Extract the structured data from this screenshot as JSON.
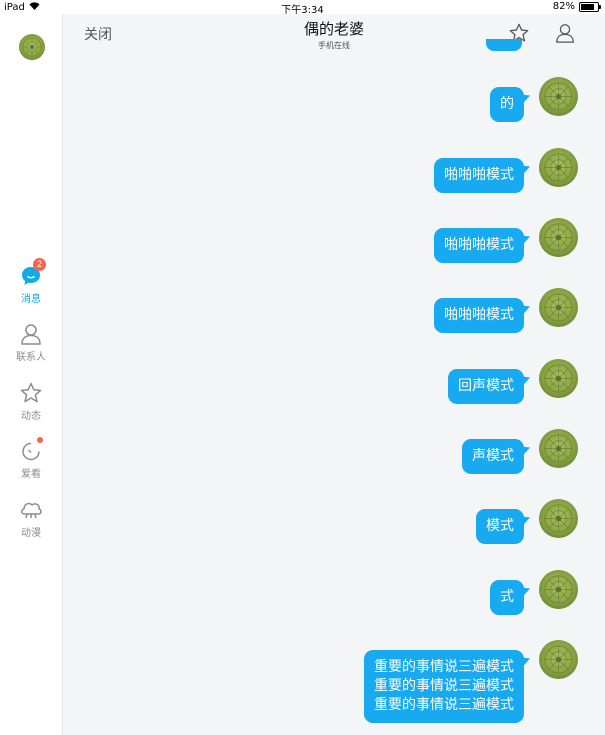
{
  "status_bar": {
    "device": "iPad",
    "time": "下午3:34",
    "battery": "82%",
    "battery_level": 0.82
  },
  "sidebar": {
    "items": [
      {
        "label": "消息",
        "icon": "chat-bubble-icon",
        "badge": "2",
        "active": true
      },
      {
        "label": "联系人",
        "icon": "person-icon"
      },
      {
        "label": "动态",
        "icon": "star-icon"
      },
      {
        "label": "爱看",
        "icon": "watch-icon",
        "dot": true
      },
      {
        "label": "动漫",
        "icon": "cloud-icon"
      }
    ]
  },
  "header": {
    "close_label": "关闭",
    "title": "偶的老婆",
    "subtitle": "手机在线",
    "favorite_icon": "star-icon",
    "profile_icon": "person-icon"
  },
  "messages": [
    {
      "lines": [
        "的"
      ]
    },
    {
      "lines": [
        "啪啪啪模式"
      ]
    },
    {
      "lines": [
        "啪啪啪模式"
      ]
    },
    {
      "lines": [
        "啪啪啪模式"
      ]
    },
    {
      "lines": [
        "回声模式"
      ]
    },
    {
      "lines": [
        "声模式"
      ]
    },
    {
      "lines": [
        "模式"
      ]
    },
    {
      "lines": [
        "式"
      ]
    },
    {
      "lines": [
        "重要的事情说三遍模式",
        "重要的事情说三遍模式",
        "重要的事情说三遍模式"
      ]
    }
  ],
  "colors": {
    "accent": "#12a9e8",
    "bubble": "#17aaf0",
    "badge": "#f5634a",
    "chat_bg": "#f3f5f7",
    "avatar_green": "#8fa84a"
  }
}
